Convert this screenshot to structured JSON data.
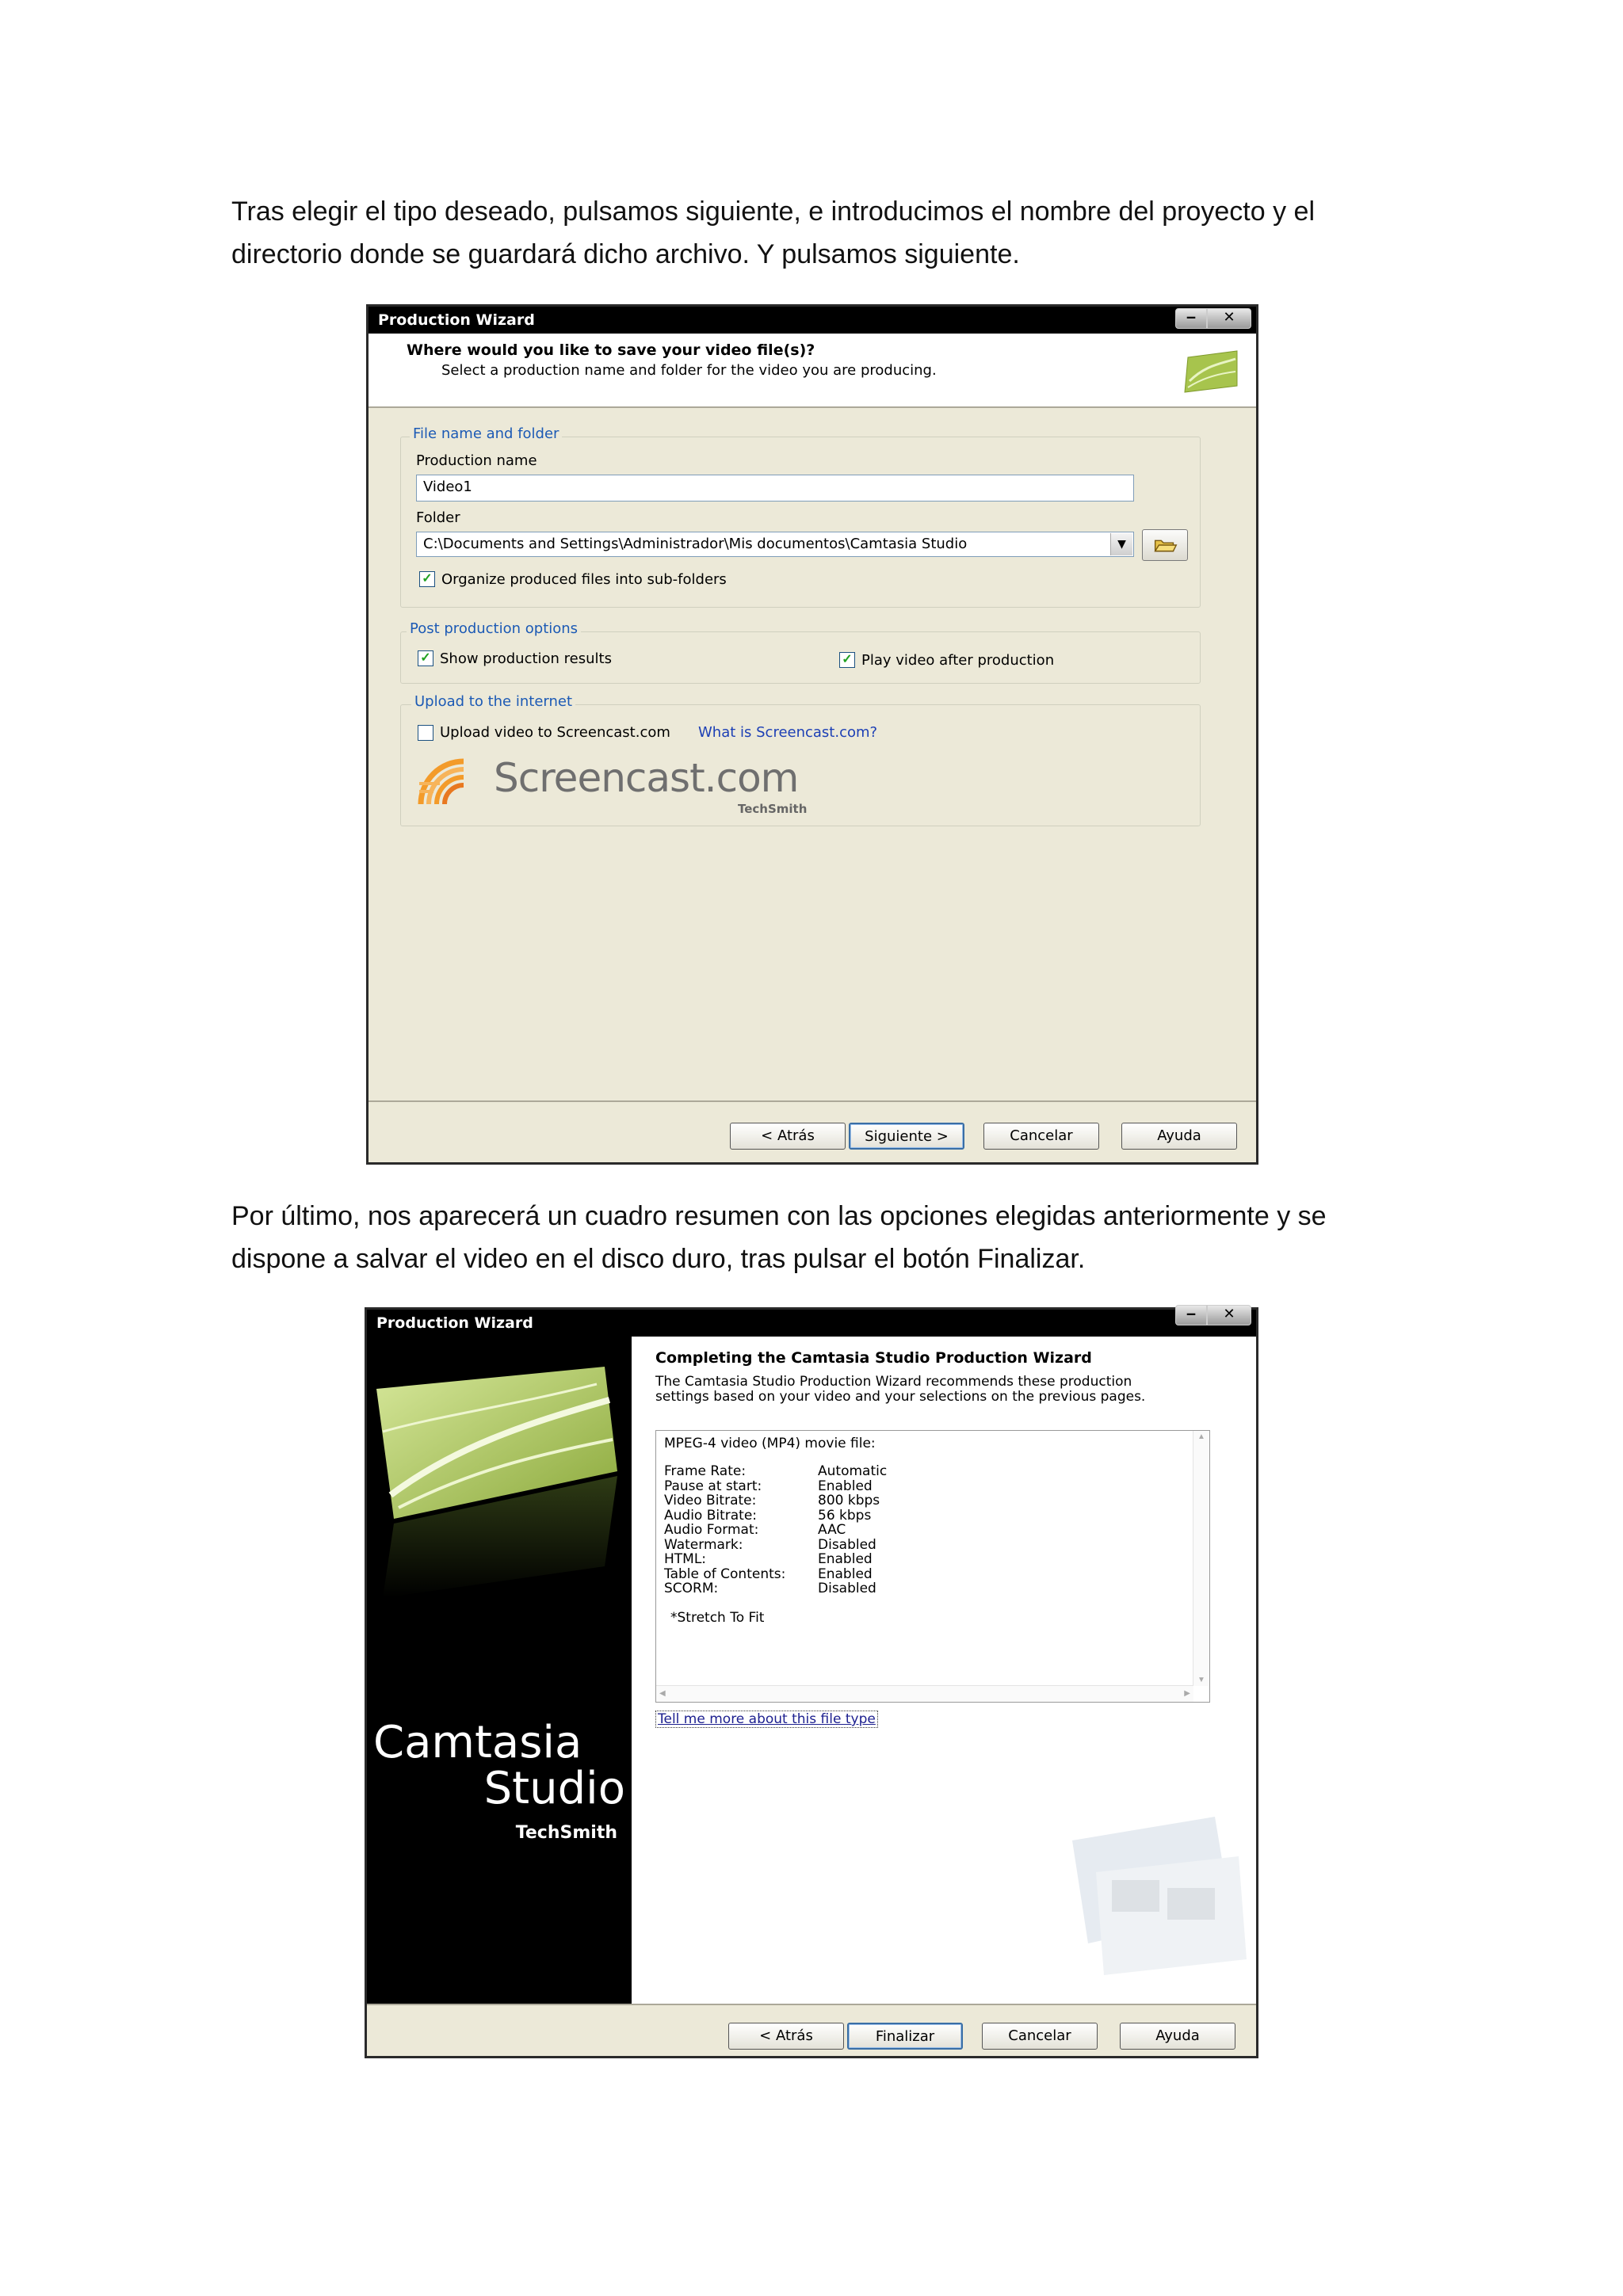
{
  "paragraphs": {
    "p1": "Tras elegir el tipo deseado, pulsamos siguiente, e introducimos el nombre del proyecto y el directorio donde se guardará dicho archivo. Y pulsamos siguiente.",
    "p2": "Por último, nos aparecerá un cuadro resumen con las opciones elegidas anteriormente y se dispone a salvar el video en el disco duro, tras pulsar el botón Finalizar."
  },
  "dialog1": {
    "title": "Production Wizard",
    "close_glyph": "✕",
    "header_title": "Where would you like to save your video file(s)?",
    "header_subtitle": "Select a production name and folder for the video you are producing.",
    "group_file": "File name and folder",
    "production_name_label": "Production name",
    "production_name_value": "Video1",
    "folder_label": "Folder",
    "folder_value": "C:\\Documents and Settings\\Administrador\\Mis documentos\\Camtasia Studio",
    "organize_label": "Organize produced files into sub-folders",
    "group_post": "Post production options",
    "show_results_label": "Show production results",
    "play_video_label": "Play video after production",
    "group_upload": "Upload to the internet",
    "upload_label": "Upload video to Screencast.com",
    "what_is_link": "What is Screencast.com?",
    "screencast_logo_text": "Screencast.com",
    "techsmith_text": "TechSmith",
    "buttons": {
      "back": "< Atrás",
      "next": "Siguiente >",
      "cancel": "Cancelar",
      "help": "Ayuda"
    },
    "checked": {
      "organize": true,
      "show_results": true,
      "play_video": true,
      "upload": false
    }
  },
  "dialog2": {
    "title": "Production Wizard",
    "close_glyph": "✕",
    "brand_line1": "Camtasia",
    "brand_line2": "Studio",
    "brand_techsmith": "TechSmith",
    "heading": "Completing the Camtasia Studio Production Wizard",
    "description": "The Camtasia Studio Production Wizard recommends these production settings based on your video and your selections on the previous pages.",
    "summary_header": "MPEG-4 video (MP4) movie file:",
    "summary_rows": [
      {
        "k": "Frame Rate:",
        "v": "Automatic"
      },
      {
        "k": "Pause at start:",
        "v": "Enabled"
      },
      {
        "k": "Video Bitrate:",
        "v": "800 kbps"
      },
      {
        "k": "Audio Bitrate:",
        "v": "56 kbps"
      },
      {
        "k": "Audio Format:",
        "v": "AAC"
      },
      {
        "k": "Watermark:",
        "v": "Disabled"
      },
      {
        "k": "HTML:",
        "v": "Enabled"
      },
      {
        "k": "Table of Contents:",
        "v": "Enabled"
      },
      {
        "k": "SCORM:",
        "v": "Disabled"
      }
    ],
    "summary_note": "*Stretch To Fit",
    "tell_me_link": "Tell me more about this file type",
    "buttons": {
      "back": "< Atrás",
      "finish": "Finalizar",
      "cancel": "Cancelar",
      "help": "Ayuda"
    }
  }
}
